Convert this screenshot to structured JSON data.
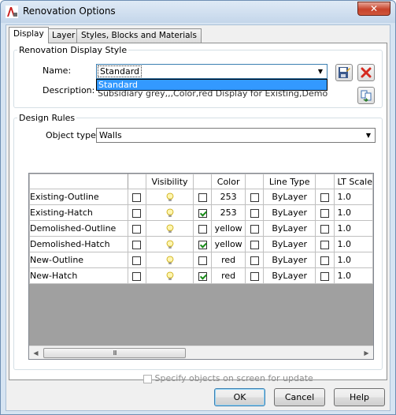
{
  "window": {
    "title": "Renovation Options",
    "close_glyph": "✕"
  },
  "tabs": [
    {
      "label": "Display",
      "active": true
    },
    {
      "label": "Layer",
      "active": false
    },
    {
      "label": "Styles, Blocks and Materials",
      "active": false
    }
  ],
  "display_style": {
    "group_title": "Renovation Display Style",
    "name_label": "Name:",
    "name_value": "Standard",
    "dropdown_options": [
      "Standard"
    ],
    "description_label": "Description:",
    "description_value": "Subsidiary grey,,,Color,red Display for Existing,Demolished,New"
  },
  "design_rules": {
    "group_title": "Design Rules",
    "object_type_label": "Object type:",
    "object_type_value": "Walls"
  },
  "grid": {
    "columns": [
      "Visibility",
      "Color",
      "Line Type",
      "LT Scale"
    ],
    "rows": [
      {
        "name": "Existing-Outline",
        "vis_checked": false,
        "color_checked": false,
        "color": "253",
        "lt_checked": false,
        "line_type": "ByLayer",
        "lts_checked": false,
        "lt_scale": "1.0"
      },
      {
        "name": "Existing-Hatch",
        "vis_checked": false,
        "color_checked": true,
        "color": "253",
        "lt_checked": false,
        "line_type": "ByLayer",
        "lts_checked": false,
        "lt_scale": "1.0"
      },
      {
        "name": "Demolished-Outline",
        "vis_checked": false,
        "color_checked": false,
        "color": "yellow",
        "lt_checked": false,
        "line_type": "ByLayer",
        "lts_checked": false,
        "lt_scale": "1.0"
      },
      {
        "name": "Demolished-Hatch",
        "vis_checked": false,
        "color_checked": true,
        "color": "yellow",
        "lt_checked": false,
        "line_type": "ByLayer",
        "lts_checked": false,
        "lt_scale": "1.0"
      },
      {
        "name": "New-Outline",
        "vis_checked": false,
        "color_checked": false,
        "color": "red",
        "lt_checked": false,
        "line_type": "ByLayer",
        "lts_checked": false,
        "lt_scale": "1.0"
      },
      {
        "name": "New-Hatch",
        "vis_checked": false,
        "color_checked": true,
        "color": "red",
        "lt_checked": false,
        "line_type": "ByLayer",
        "lts_checked": false,
        "lt_scale": "1.0"
      }
    ],
    "scroll_grip": "III"
  },
  "specify_objects": {
    "label": "Specify objects on screen for update",
    "checked": false,
    "enabled": false
  },
  "buttons": {
    "ok": "OK",
    "cancel": "Cancel",
    "help": "Help"
  },
  "colors": {
    "accent": "#3399ff",
    "grid_empty": "#a0a0a0",
    "delete_red": "#d52a1f"
  }
}
